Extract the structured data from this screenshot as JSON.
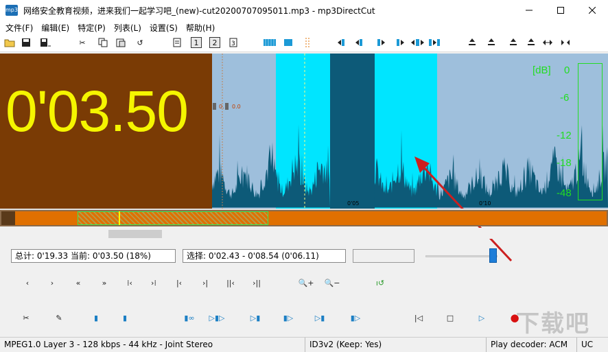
{
  "window": {
    "app_icon": "mp3",
    "title": "网络安全教育视频，进来我们一起学习吧_(new)-cut20200707095011.mp3 - mp3DirectCut",
    "controls": [
      "minimize-icon",
      "maximize-icon",
      "close-icon"
    ]
  },
  "menu": [
    {
      "label": "文件(F)"
    },
    {
      "label": "编辑(E)"
    },
    {
      "label": "特定(P)"
    },
    {
      "label": "列表(L)"
    },
    {
      "label": "设置(S)"
    },
    {
      "label": "帮助(H)"
    }
  ],
  "toolbar": {
    "icons": [
      "open-folder-icon",
      "save-icon",
      "save-split-icon",
      "cut-icon",
      "copy-icon",
      "paste-icon",
      "undo-icon",
      "document-icon",
      "page-1-icon",
      "page-2-icon",
      "page-3-icon",
      "view-waveform-icon",
      "view-block-icon",
      "view-dotted-icon",
      "marker-prev-icon",
      "marker-left-icon",
      "marker-mid-icon",
      "marker-right-icon",
      "marker-both-icon",
      "marker-split-icon",
      "jump-1-icon",
      "jump-2-icon",
      "jump-3-icon",
      "jump-4-icon",
      "expand-icon",
      "collapse-icon"
    ]
  },
  "display": {
    "time": "0'03.50",
    "marker_left_label": "0.",
    "marker_right_label": "0.0",
    "time_ticks": [
      "0'05",
      "0'10"
    ],
    "db_labels": [
      "[dB]",
      "0",
      "-6",
      "-12",
      "-18",
      "-48"
    ]
  },
  "overview": {
    "selection_start_fraction": 0.105,
    "selection_end_fraction": 0.428,
    "cursor_fraction": 0.175
  },
  "info": {
    "total_label": "总计: 0'19.33   当前: 0'03.50   (18%)",
    "selection_label": "选择: 0'02.43 - 0'08.54 (0'06.11)",
    "extra": "",
    "volume_fraction": 0.9
  },
  "controls_row1": [
    {
      "icon": "step-back-icon",
      "glyph": "‹"
    },
    {
      "icon": "step-forward-icon",
      "glyph": "›"
    },
    {
      "icon": "fast-back-icon",
      "glyph": "«"
    },
    {
      "icon": "fast-forward-icon",
      "glyph": "»"
    },
    {
      "icon": "to-sel-start-icon",
      "glyph": "⁞‹"
    },
    {
      "icon": "to-sel-end-icon",
      "glyph": "›⁞"
    },
    {
      "icon": "to-begin-icon",
      "glyph": "|‹"
    },
    {
      "icon": "to-end-icon",
      "glyph": "›|"
    },
    {
      "icon": "prev-cue-icon",
      "glyph": "||‹"
    },
    {
      "icon": "next-cue-icon",
      "glyph": "›||"
    },
    {
      "icon": "zoom-in-icon",
      "glyph": "🔍+"
    },
    {
      "icon": "zoom-out-icon",
      "glyph": "🔍−"
    },
    {
      "icon": "level-undo-icon",
      "glyph": "ı↺"
    }
  ],
  "controls_row2": [
    {
      "icon": "cut-scissors-icon",
      "glyph": "✂"
    },
    {
      "icon": "pencil-icon",
      "glyph": "✎"
    },
    {
      "icon": "set-begin-icon",
      "glyph": "▮"
    },
    {
      "icon": "set-end-icon",
      "glyph": "▮"
    },
    {
      "icon": "loop-icon",
      "glyph": "▮∞"
    },
    {
      "icon": "play-selection-icon",
      "glyph": "▷▮▷"
    },
    {
      "icon": "play-to-mark-icon",
      "glyph": "▷▮"
    },
    {
      "icon": "play-from-mark-icon",
      "glyph": "▮▷"
    },
    {
      "icon": "play-end-icon",
      "glyph": "▷▮"
    },
    {
      "icon": "play-after-icon",
      "glyph": "▮▷"
    }
  ],
  "transport": [
    {
      "icon": "skip-start-icon",
      "glyph": "|◁"
    },
    {
      "icon": "stop-icon",
      "glyph": "□"
    },
    {
      "icon": "play-icon",
      "glyph": "▷"
    },
    {
      "icon": "record-icon",
      "glyph": "●"
    }
  ],
  "status": {
    "format": "MPEG1.0 Layer 3 - 128 kbps - 44 kHz - Joint Stereo",
    "id3": "ID3v2 (Keep: Yes)",
    "decoder": "Play decoder: ACM",
    "mode": "UC"
  },
  "watermark": "下载吧",
  "colors": {
    "time_bg": "#7a3b05",
    "time_text": "#f5f500",
    "wave_bg": "#9ebfdc",
    "selection_cyan": "#00e5ff",
    "waveform": "#0d5a78",
    "db_green": "#22dd22",
    "overview_orange": "#e07000",
    "arrow_red": "#cc1f1f"
  }
}
